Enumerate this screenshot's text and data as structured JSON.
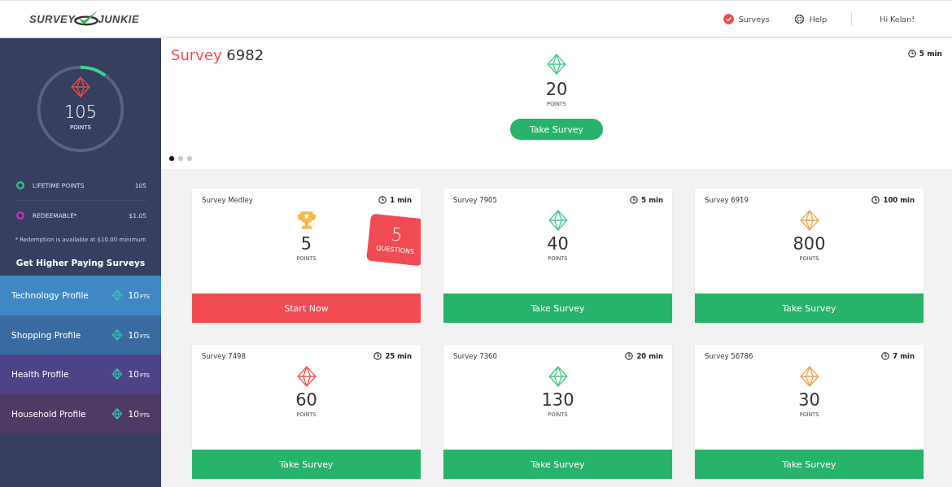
{
  "header": {
    "logo": {
      "left": "SURVEY",
      "right": "JUNKIE"
    },
    "nav": [
      {
        "label": "Surveys",
        "kind": "surveys"
      },
      {
        "label": "Help",
        "kind": "help"
      }
    ],
    "greeting": "Hi Kelan!"
  },
  "sidebar": {
    "points": {
      "value": "105",
      "unit": "POINTS",
      "level": 0.1
    },
    "stats": [
      {
        "label": "LIFETIME POINTS",
        "value": "105",
        "color": "#2fbf8a"
      },
      {
        "label": "REDEEMABLE*",
        "value": "$1.05",
        "color": "#b535c0"
      }
    ],
    "note": "* Redemption is available at $10.00 minimum",
    "heading": "Get Higher Paying Surveys",
    "profiles": [
      {
        "label": "Technology Profile",
        "points": "10",
        "unit": "PTS",
        "color": "#3f88c5"
      },
      {
        "label": "Shopping Profile",
        "points": "10",
        "unit": "PTS",
        "color": "#3a6ba0"
      },
      {
        "label": "Health Profile",
        "points": "10",
        "unit": "PTS",
        "color": "#4d4488"
      },
      {
        "label": "Household Profile",
        "points": "10",
        "unit": "PTS",
        "color": "#4e3a64"
      }
    ]
  },
  "featured": {
    "title_prefix": "Survey",
    "title_number": "6982",
    "duration": "5 min",
    "points": "20",
    "unit": "POINTS",
    "color": "#3ec98a",
    "button": "Take Survey",
    "dots": [
      {
        "selected": true
      },
      {
        "selected": false
      },
      {
        "selected": false
      }
    ]
  },
  "cards": [
    {
      "kind": "medley",
      "title": "Survey Medley",
      "duration": "1 min",
      "points": "5",
      "unit": "POINTS",
      "badge_number": "5",
      "badge_label": "QUESTIONS",
      "button": "Start Now"
    },
    {
      "kind": "survey",
      "title": "Survey 7905",
      "duration": "5 min",
      "points": "40",
      "unit": "POINTS",
      "color": "#3ec98a",
      "button": "Take Survey"
    },
    {
      "kind": "survey",
      "title": "Survey 6919",
      "duration": "100 min",
      "points": "800",
      "unit": "POINTS",
      "color": "#f0a050",
      "button": "Take Survey"
    },
    {
      "kind": "survey",
      "title": "Survey 7498",
      "duration": "25 min",
      "points": "60",
      "unit": "POINTS",
      "color": "#f05050",
      "button": "Take Survey"
    },
    {
      "kind": "survey",
      "title": "Survey 7360",
      "duration": "20 min",
      "points": "130",
      "unit": "POINTS",
      "color": "#3ec98a",
      "button": "Take Survey"
    },
    {
      "kind": "survey",
      "title": "Survey 56786",
      "duration": "7 min",
      "points": "30",
      "unit": "POINTS",
      "color": "#f0a050",
      "button": "Take Survey"
    }
  ]
}
